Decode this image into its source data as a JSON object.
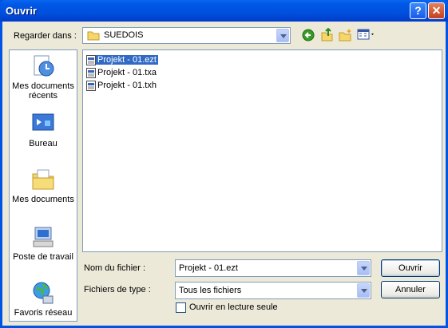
{
  "window": {
    "title": "Ouvrir"
  },
  "lookin": {
    "label": "Regarder dans :",
    "folder": "SUEDOIS"
  },
  "places": [
    {
      "label": "Mes documents récents"
    },
    {
      "label": "Bureau"
    },
    {
      "label": "Mes documents"
    },
    {
      "label": "Poste de travail"
    },
    {
      "label": "Favoris réseau"
    }
  ],
  "files": [
    {
      "name": "Projekt - 01.ezt",
      "selected": true
    },
    {
      "name": "Projekt - 01.txa",
      "selected": false
    },
    {
      "name": "Projekt - 01.txh",
      "selected": false
    }
  ],
  "filename": {
    "label": "Nom du fichier :",
    "value": "Projekt - 01.ezt"
  },
  "filetype": {
    "label": "Fichiers de type :",
    "value": "Tous les fichiers"
  },
  "readonly": {
    "label": "Ouvrir en lecture seule",
    "checked": false
  },
  "buttons": {
    "open": "Ouvrir",
    "cancel": "Annuler"
  }
}
